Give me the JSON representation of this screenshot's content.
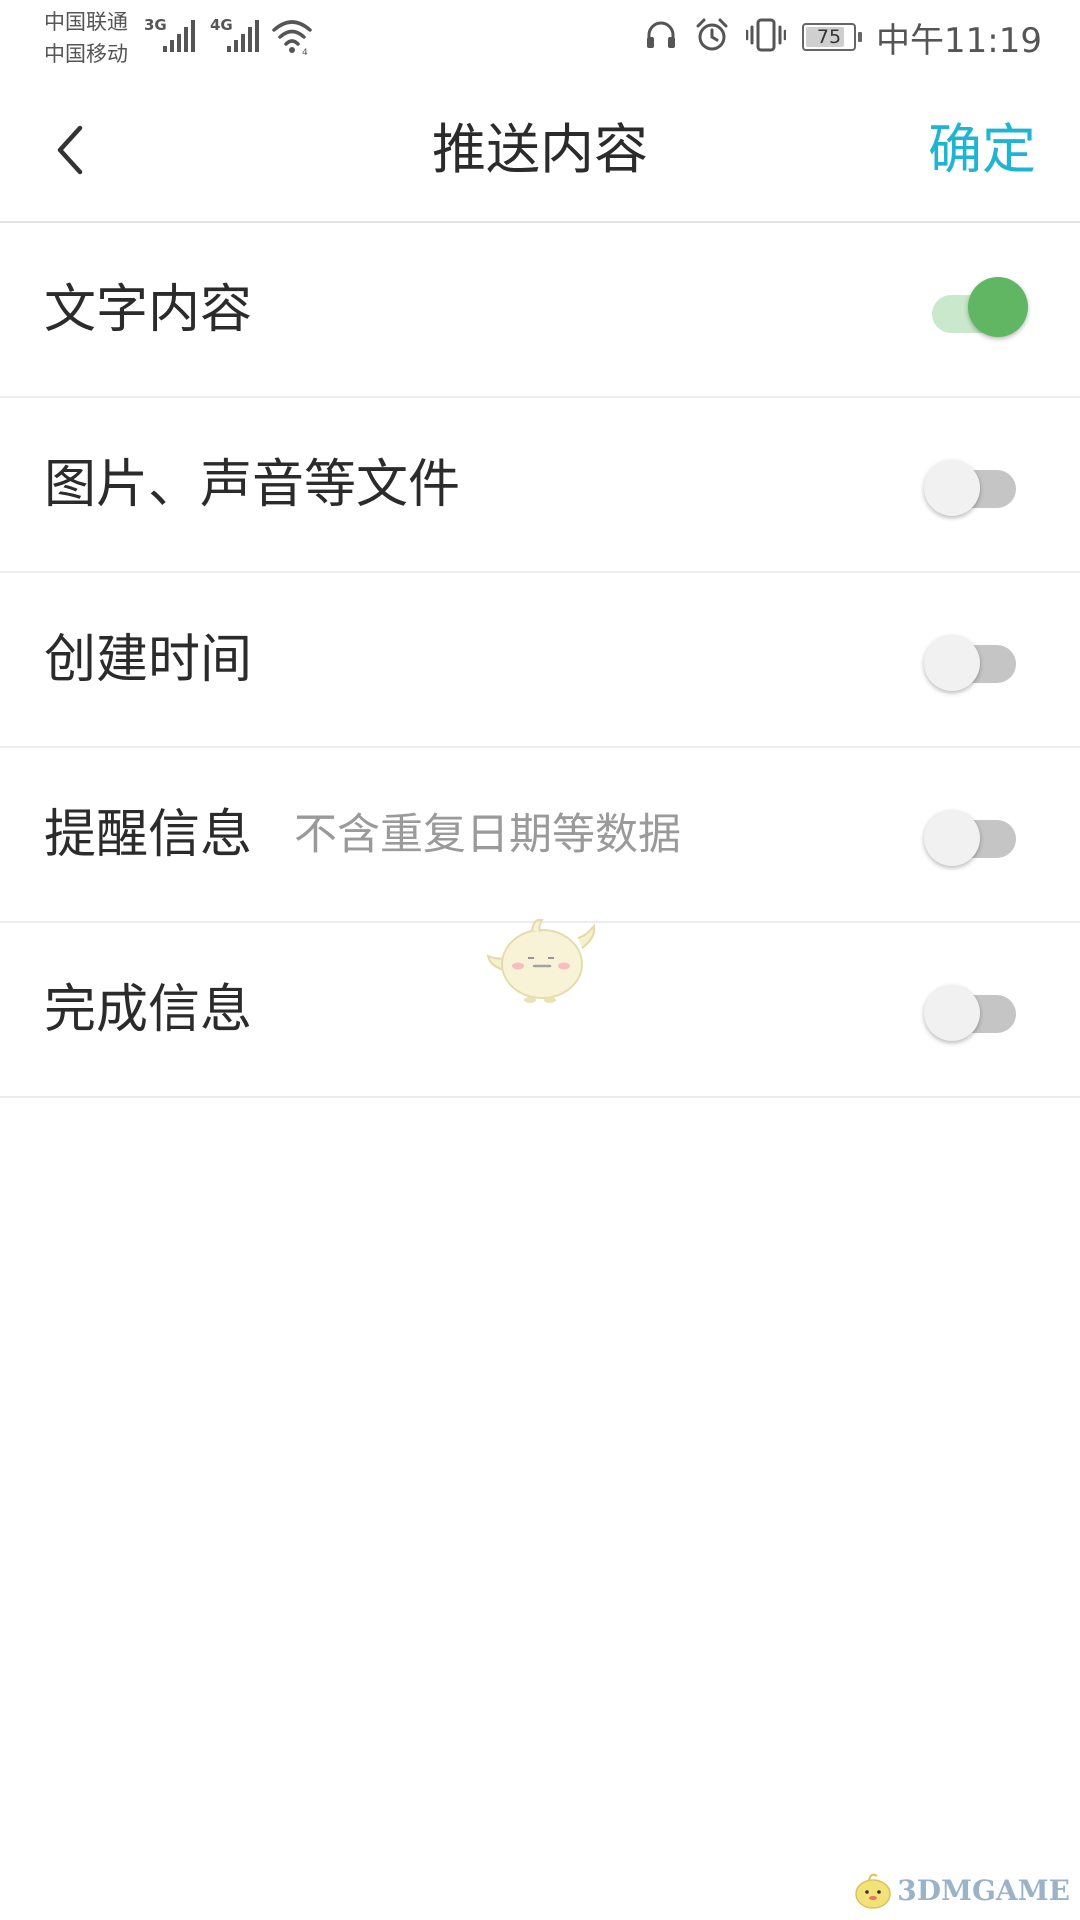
{
  "status_bar": {
    "carrier_1": "中国联通",
    "carrier_2": "中国移动",
    "network_1": "3G",
    "network_2": "4G",
    "battery_level": "75",
    "time": "中午11:19",
    "icons": [
      "headphones-icon",
      "alarm-icon",
      "vibrate-icon",
      "battery-icon"
    ]
  },
  "header": {
    "title": "推送内容",
    "back_icon": "chevron-left-icon",
    "confirm_label": "确定",
    "accent_color": "#1fb4d2"
  },
  "settings": [
    {
      "label": "文字内容",
      "sublabel": "",
      "enabled": true
    },
    {
      "label": "图片、声音等文件",
      "sublabel": "",
      "enabled": false
    },
    {
      "label": "创建时间",
      "sublabel": "",
      "enabled": false
    },
    {
      "label": "提醒信息",
      "sublabel": "不含重复日期等数据",
      "enabled": false
    },
    {
      "label": "完成信息",
      "sublabel": "",
      "enabled": false
    }
  ],
  "toggle_colors": {
    "on_thumb": "#61b664",
    "on_track": "#c9e8cc",
    "off_thumb": "#f1f1f1",
    "off_track": "#c5c5c5"
  },
  "watermark": {
    "brand": "3DMGAME"
  }
}
